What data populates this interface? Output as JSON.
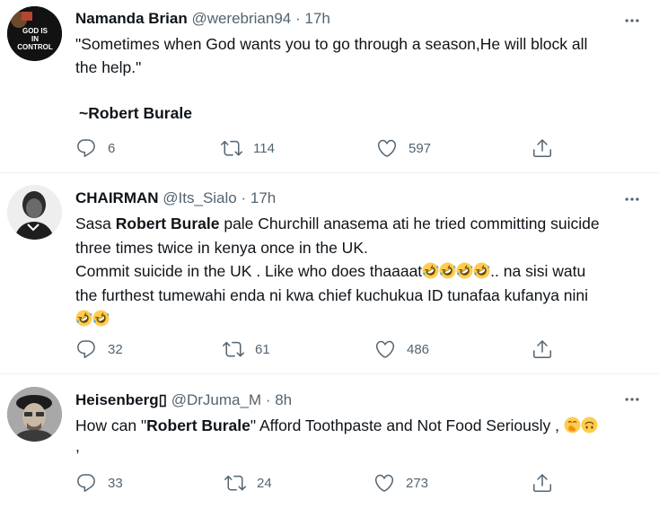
{
  "tweets": [
    {
      "name": "Namanda Brian",
      "handle": "@werebrian94",
      "sep": "·",
      "time": "17h",
      "avatar_text": [
        "GOD IS",
        "IN",
        "CONTROL"
      ],
      "line1": "\"Sometimes when God wants you to go through a season,He will block all",
      "line2": "the help.\"",
      "signature": "~Robert Burale",
      "replies": "6",
      "retweets": "114",
      "likes": "597"
    },
    {
      "name": "CHAIRMAN",
      "handle": "@Its_Sialo",
      "sep": "·",
      "time": "17h",
      "l1_pre": "Sasa ",
      "l1_bold": "Robert Burale",
      "l1_post": " pale Churchill anasema ati he tried committing suicide",
      "l2": "three times twice in kenya once in the UK.",
      "l3_pre": "Commit suicide in the UK . Like who does thaaaat",
      "l3_post": ".. na sisi watu",
      "l4": "the furthest tumewahi enda ni kwa chief kuchukua ID tunafaa kufanya nini",
      "replies": "32",
      "retweets": "61",
      "likes": "486"
    },
    {
      "name": "Heisenberg▯",
      "handle": "@DrJuma_M",
      "sep": "·",
      "time": "8h",
      "l1_pre": "How can \"",
      "l1_bold": "Robert Burale",
      "l1_post": "\" Afford Toothpaste and Not Food Seriously ,",
      "l2": ",",
      "replies": "33",
      "retweets": "24",
      "likes": "273"
    }
  ],
  "icons": [
    "reply-icon",
    "retweet-icon",
    "like-icon",
    "share-icon",
    "more-icon",
    "rofl-emoji",
    "hand-over-mouth-emoji",
    "upside-down-face-emoji"
  ],
  "colors": {
    "text": "#0f1419",
    "muted": "#536471",
    "divider": "#eff3f4",
    "emoji": "#ffcc4d"
  }
}
